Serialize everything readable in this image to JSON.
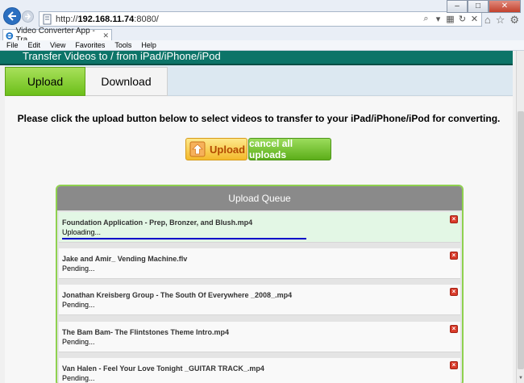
{
  "browser": {
    "url_prefix": "http://",
    "url_host": "192.168.11.74",
    "url_port": ":8080/",
    "tab_title": "Video Converter App - Tra...",
    "menu": [
      "File",
      "Edit",
      "View",
      "Favorites",
      "Tools",
      "Help"
    ]
  },
  "app": {
    "header_title": "Transfer Videos to / from iPad/iPhone/iPod",
    "tabs": [
      {
        "label": "Upload",
        "active": true
      },
      {
        "label": "Download",
        "active": false
      }
    ],
    "instruction": "Please click the upload button below to select videos to transfer to your iPad/iPhone/iPod for converting.",
    "upload_label": "Upload",
    "cancel_label": "cancel all uploads"
  },
  "queue": {
    "title": "Upload Queue",
    "items": [
      {
        "name": "Foundation Application - Prep, Bronzer, and Blush.mp4",
        "status": "Uploading...",
        "progress": 0.78
      },
      {
        "name": "Jake and Amir_ Vending Machine.flv",
        "status": "Pending..."
      },
      {
        "name": "Jonathan Kreisberg Group - The South Of Everywhere _2008_.mp4",
        "status": "Pending..."
      },
      {
        "name": "The Bam Bam- The Flintstones Theme Intro.mp4",
        "status": "Pending..."
      },
      {
        "name": "Van Halen - Feel Your Love Tonight _GUITAR TRACK_.mp4",
        "status": "Pending..."
      }
    ]
  },
  "colors": {
    "header_bg": "#0c7468",
    "upload_tab_bg": "#6cbf1a",
    "progress": "#0000c8",
    "queue_border": "#8fd14f"
  }
}
